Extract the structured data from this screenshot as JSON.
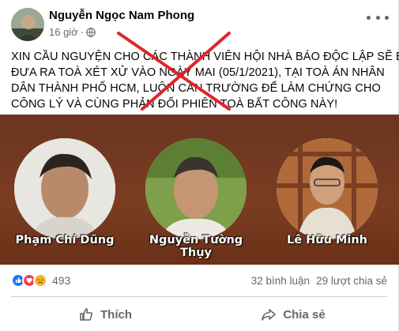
{
  "post": {
    "author": "Nguyễn Ngọc Nam Phong",
    "time": "16 giờ",
    "text_lines": [
      "XIN CẦU NGUYỆN CHO CÁC THÀNH VIÊN HỘI NHÀ BÁO ĐỘC LẬP SẼ BỊ",
      "ĐƯA RA TOÀ XÉT XỬ VÀO NGÀY MAI (05/1/2021), TẠI TOÀ ÁN NHÂN",
      "DÂN THÀNH PHỐ HCM, LUÔN CAN TRƯỜNG ĐỂ LÀM CHỨNG CHO",
      "CÔNG LÝ VÀ CÙNG PHẢN ĐỐI PHIÊN TOÀ BẤT CÔNG NÀY!"
    ]
  },
  "image": {
    "people": [
      {
        "name": "Phạm Chí Dũng"
      },
      {
        "name": "Nguyễn Tường Thụy"
      },
      {
        "name": "Lê Hữu Minh"
      }
    ]
  },
  "stats": {
    "reaction_count": "493",
    "comments": "32 bình luận",
    "shares": "29 lượt chia sẻ"
  },
  "actions": {
    "like": "Thích",
    "share": "Chia sẻ"
  },
  "colors": {
    "like_blue": "#1877f2",
    "love_red": "#f33e58",
    "haha_yellow": "#f7b125",
    "strike_red": "#e0242a",
    "banner_brown": "#6b3520"
  }
}
